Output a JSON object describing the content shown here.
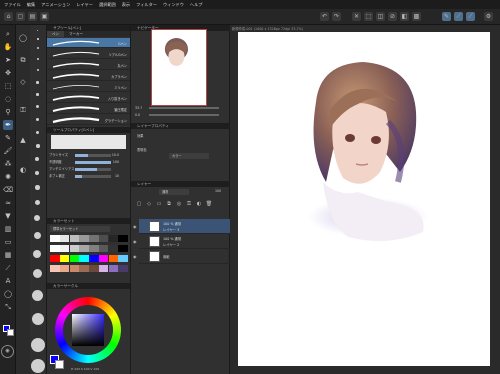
{
  "menu": [
    "ファイル",
    "編集",
    "アニメーション",
    "レイヤー",
    "選択範囲",
    "表示",
    "フィルター",
    "ウィンドウ",
    "ヘルプ"
  ],
  "left_panel": {
    "subtool_title": "サブツール[ペン]",
    "tabs": [
      "ペン",
      "マーカー"
    ],
    "brushes": [
      "Gペン",
      "リアルGペン",
      "丸ペン",
      "カブラペン",
      "ミリペン",
      "入り抜きペン",
      "筆圧限定",
      "グラデーション"
    ],
    "selected_brush": "Gペン",
    "tool_prop_title": "ツールプロパティ[Gペン]",
    "settings": [
      {
        "label": "ブラシサイズ",
        "value": "10.0",
        "fill": 0.35
      },
      {
        "label": "不透明度",
        "value": "100",
        "fill": 1.0
      },
      {
        "label": "アンチエイリアス",
        "value": "",
        "fill": 0.6
      },
      {
        "label": "手ブレ補正",
        "value": "10",
        "fill": 0.2
      }
    ],
    "color_set_title": "カラーセット",
    "color_set_name": "標準カラーセット",
    "color_wheel_title": "カラーサークル",
    "color_readout": "H 243 S 100 V 100"
  },
  "center_panel": {
    "navigator_title": "ナビゲーター",
    "zoom": "33.7",
    "rotation": "0.0",
    "layer_prop_title": "レイヤープロパティ",
    "effect_label": "効果",
    "expression_label": "表現色",
    "expression_value": "カラー",
    "layer_title": "レイヤー",
    "blend_mode": "通常",
    "opacity": "100",
    "layers": [
      {
        "name": "レイヤー 3",
        "mode": "100 % 通常",
        "selected": true
      },
      {
        "name": "レイヤー 2",
        "mode": "100 % 通常",
        "selected": false
      },
      {
        "name": "用紙",
        "mode": "",
        "selected": false
      }
    ]
  },
  "canvas": {
    "status": "新規作成-001 (1000 x 1326px 72dpi 33.7%)"
  },
  "colors": {
    "accent": "#4a78a6",
    "main_color": "#0a00ff",
    "sub_color": "#ffffff"
  }
}
